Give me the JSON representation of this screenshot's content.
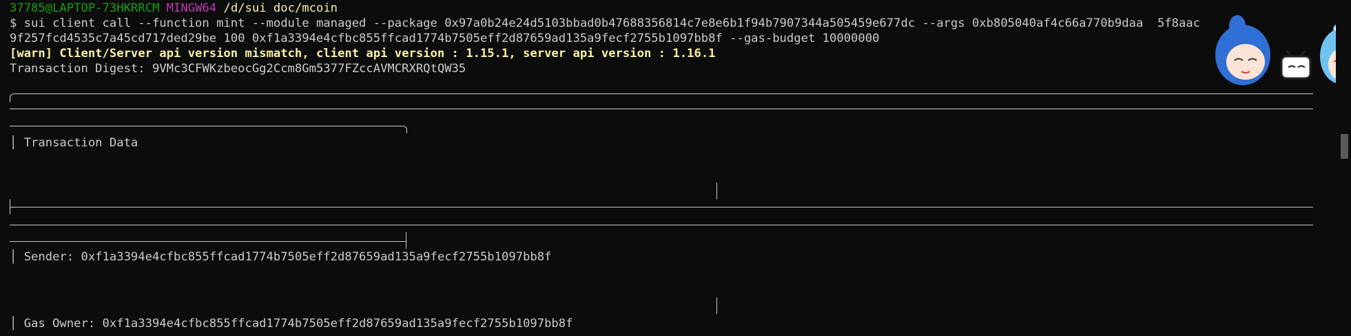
{
  "prompt": {
    "user_host": "37785@LAPTOP-73HKRRCM",
    "shell": "MINGW64",
    "cwd": "/d/sui doc/mcoin"
  },
  "command": {
    "line1": "$ sui client call --function mint --module managed --package 0x97a0b24e24d5103bbad0b47688356814c7e8e6b1f94b7907344a505459e677dc --args 0xb805040af4c66a770b9daa  5f8aac",
    "line2": "9f257fcd4535c7a45cd717ded29be 100 0xf1a3394e4cfbc855ffcad1774b7505eff2d87659ad135a9fecf2755b1097bb8f --gas-budget 10000000"
  },
  "warning": "[warn] Client/Server api version mismatch, client api version : 1.15.1, server api version : 1.16.1",
  "digest": "Transaction Digest: 9VMc3CFWKzbeocGg2Ccm8Gm5377FZccAVMCRXRQtQW35",
  "sections": {
    "transaction_data": "│ Transaction Data",
    "sender": "│ Sender: 0xf1a3394e4cfbc855ffcad1774b7505eff2d87659ad135a9fecf2755b1097bb8f",
    "gas_owner": "│ Gas Owner: 0xf1a3394e4cfbc855ffcad1774b7505eff2d87659ad135a9fecf2755b1097bb8f"
  },
  "colors": {
    "background": "#0c0c0c",
    "text": "#cccccc",
    "prompt_green": "#13a10e",
    "prompt_magenta": "#c239b3",
    "prompt_yellow": "#f9f1a5",
    "warning_yellow": "#f9f1a5"
  },
  "decorations": {
    "mascot": "anime-mascot-sticker"
  }
}
